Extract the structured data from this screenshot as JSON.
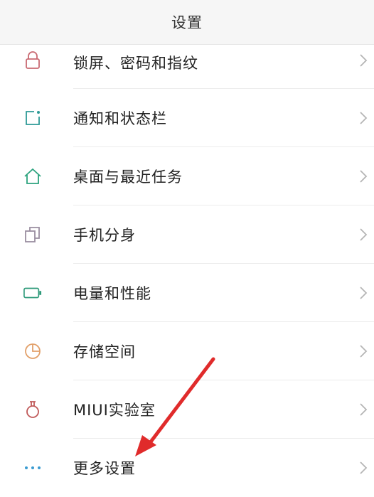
{
  "header": {
    "title": "设置"
  },
  "items": [
    {
      "label": "锁屏、密码和指纹",
      "icon": "lock-icon",
      "color": "#c96a72"
    },
    {
      "label": "通知和状态栏",
      "icon": "notification-icon",
      "color": "#2e9a97"
    },
    {
      "label": "桌面与最近任务",
      "icon": "home-icon",
      "color": "#2ca37e"
    },
    {
      "label": "手机分身",
      "icon": "clone-icon",
      "color": "#9a8ea0"
    },
    {
      "label": "电量和性能",
      "icon": "battery-icon",
      "color": "#2e9a7a"
    },
    {
      "label": "存储空间",
      "icon": "storage-pie-icon",
      "color": "#e2a06a"
    },
    {
      "label": "MIUI实验室",
      "icon": "lab-flask-icon",
      "color": "#c05a5a"
    },
    {
      "label": "更多设置",
      "icon": "more-dots-icon",
      "color": "#3a9bd1"
    }
  ],
  "annotation": {
    "arrow_color": "#e02b2b"
  }
}
